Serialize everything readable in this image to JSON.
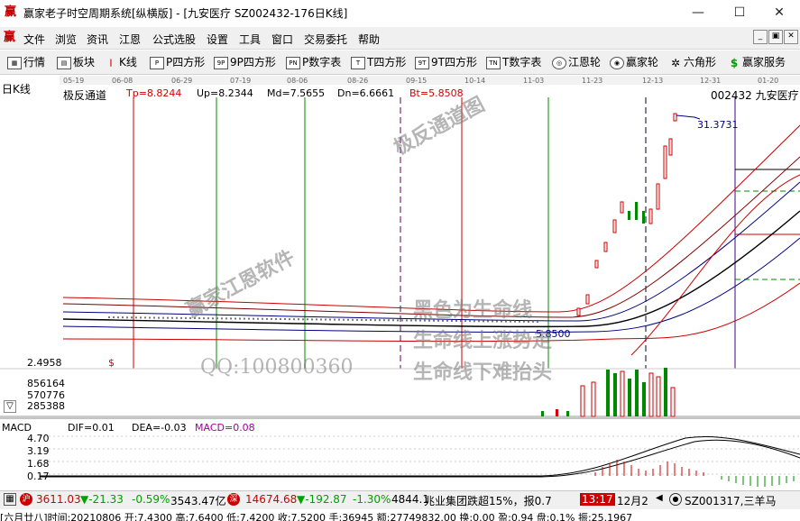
{
  "window": {
    "title": "赢家老子时空周期系统[纵横版] - [九安医疗  SZ002432-176日K线]",
    "min": "—",
    "max": "☐",
    "close": "✕"
  },
  "menu": [
    "文件",
    "浏览",
    "资讯",
    "江恩",
    "公式选股",
    "设置",
    "工具",
    "窗口",
    "交易委托",
    "帮助"
  ],
  "toolbar": [
    {
      "label": "行情",
      "icon": "grid-icon"
    },
    {
      "label": "板块",
      "icon": "sectors-icon"
    },
    {
      "label": "K线",
      "icon": "candlestick-icon"
    },
    {
      "label": "P四方形",
      "icon": "P"
    },
    {
      "label": "9P四方形",
      "icon": "9P"
    },
    {
      "label": "P数字表",
      "icon": "PN"
    },
    {
      "label": "T四方形",
      "icon": "T"
    },
    {
      "label": "9T四方形",
      "icon": "9T"
    },
    {
      "label": "T数字表",
      "icon": "TN"
    },
    {
      "label": "江恩轮",
      "icon": "gann-wheel-icon"
    },
    {
      "label": "赢家轮",
      "icon": "winner-wheel-icon"
    },
    {
      "label": "六角形",
      "icon": "hexagon-icon"
    },
    {
      "label": "赢家服务",
      "icon": "dollar-icon"
    }
  ],
  "chart": {
    "period_label": "日K线",
    "indicator": "极反通道",
    "tp": "Tp=8.8244",
    "up": "Up=8.2344",
    "md": "Md=7.5655",
    "dn": "Dn=6.6661",
    "bt": "Bt=5.8508",
    "stock": "002432 九安医疗",
    "dates": [
      "05-19",
      "06-08",
      "06-29",
      "07-19",
      "08-06",
      "08-26",
      "09-15",
      "10-14",
      "11-03",
      "11-23",
      "12-13",
      "12-31",
      "01-20"
    ],
    "price_low_label": "2.4958",
    "high_label": "31.3731",
    "low_marker": "5.8500",
    "dollar": "$",
    "volume_ticks": [
      "856164",
      "570776",
      "285388"
    ],
    "watermarks": [
      "极反通道图",
      "赢家江恩软件",
      "QQ:100800360",
      "黑色为生命线",
      "生命线上涨势走",
      "生命线下难抬头"
    ]
  },
  "chart_data": {
    "type": "candlestick",
    "price_axis_labels": [
      "2.4958"
    ],
    "price_annotation": "31.3731",
    "low_annotation": "5.8500",
    "volume_axis_labels": [
      856164,
      570776,
      285388
    ],
    "macd": {
      "label": "MACD",
      "dif": "DIF=0.01",
      "dea": "DEA=-0.03",
      "macd": "MACD=0.08",
      "axis": [
        "4.70",
        "3.19",
        "1.68",
        "0.17"
      ]
    }
  },
  "status": {
    "sh_index": "3611.03",
    "sh_change": "▼-21.33",
    "sh_pct": "-0.59%",
    "sh_amount": "3543.47亿",
    "sz_index": "14674.68",
    "sz_change": "▼-192.87",
    "sz_pct": "-1.30%",
    "sz_amount": "4844.1",
    "ticker": "兆业集团跌超15%，报0.7",
    "time": "13:17",
    "date": "12月2",
    "stock": "SZ001317,三羊马"
  },
  "info_line": "[六月廿八]时间:20210806 开:7.4300 高:7.6400 低:7.4200 收:7.5200 手:36945 额:27749832.00 换:0.00 盈:0.94 盘:0.1% 振:25.1967"
}
